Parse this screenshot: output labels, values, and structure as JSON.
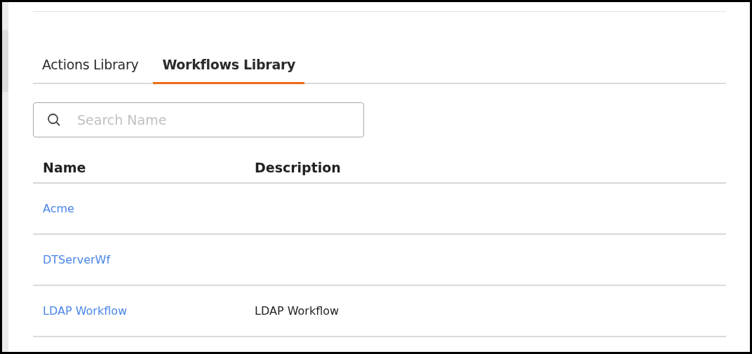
{
  "tabs": [
    {
      "label": "Actions Library",
      "selected": false
    },
    {
      "label": "Workflows Library",
      "selected": true
    }
  ],
  "search": {
    "placeholder": "Search Name"
  },
  "table": {
    "columns": [
      "Name",
      "Description"
    ],
    "rows": [
      {
        "name": "Acme"
      },
      {
        "name": "DTServerWf"
      },
      {
        "name": "LDAP Workflow",
        "description": "LDAP Workflow"
      }
    ]
  }
}
